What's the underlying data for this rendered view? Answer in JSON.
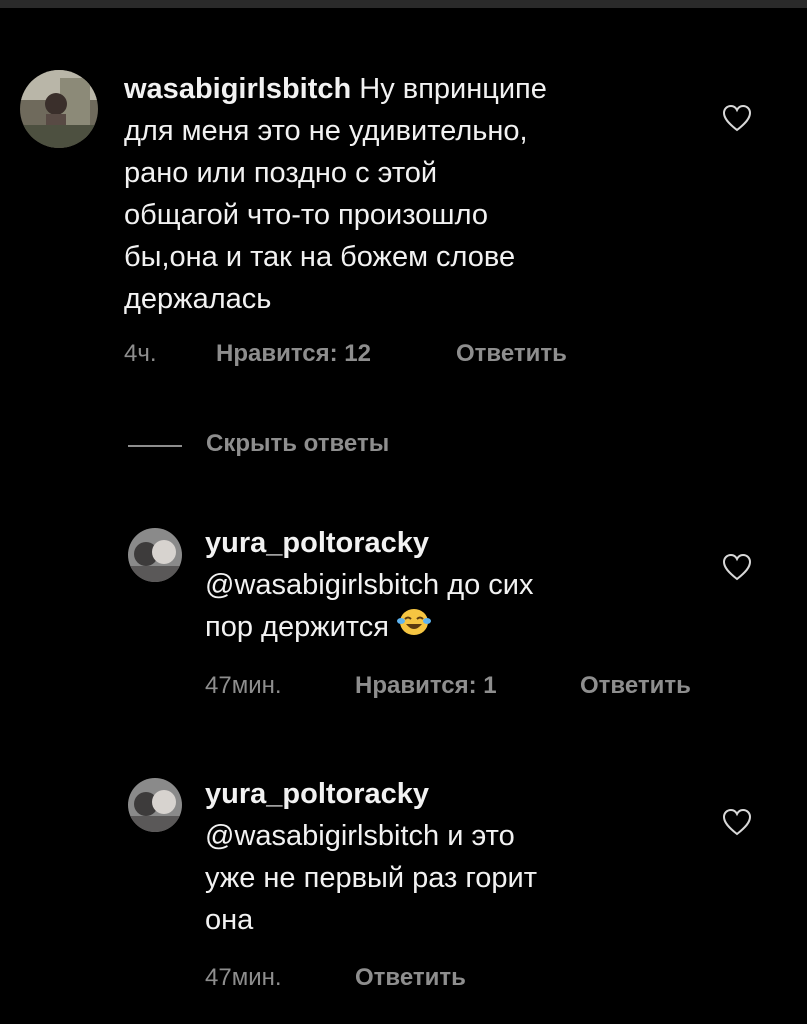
{
  "comments": [
    {
      "username": "wasabigirlsbitch",
      "text": "Ну впринципе\nдля меня это не удивительно,\nрано или поздно с этой\nобщагой что-то произошло\nбы,она и так на божем слове\nдержалась",
      "time": "4ч.",
      "likes": "Нравится: 12",
      "reply": "Ответить"
    }
  ],
  "hide_replies": "Скрыть ответы",
  "replies": [
    {
      "username": "yura_poltoracky",
      "mention": "@wasabigirlsbitch",
      "text_line1": " до сих",
      "text_line2": "пор держится ",
      "emoji": "joy-emoji",
      "time": "47мин.",
      "likes": "Нравится: 1",
      "reply": "Ответить"
    },
    {
      "username": "yura_poltoracky",
      "mention": "@wasabigirlsbitch",
      "text_line1": " и это",
      "text_line2": "уже не первый раз горит\nона",
      "time": "47мин.",
      "reply": "Ответить"
    }
  ],
  "colors": {
    "background": "#000000",
    "text": "#f2f2f2",
    "meta": "#8e8e8e"
  }
}
